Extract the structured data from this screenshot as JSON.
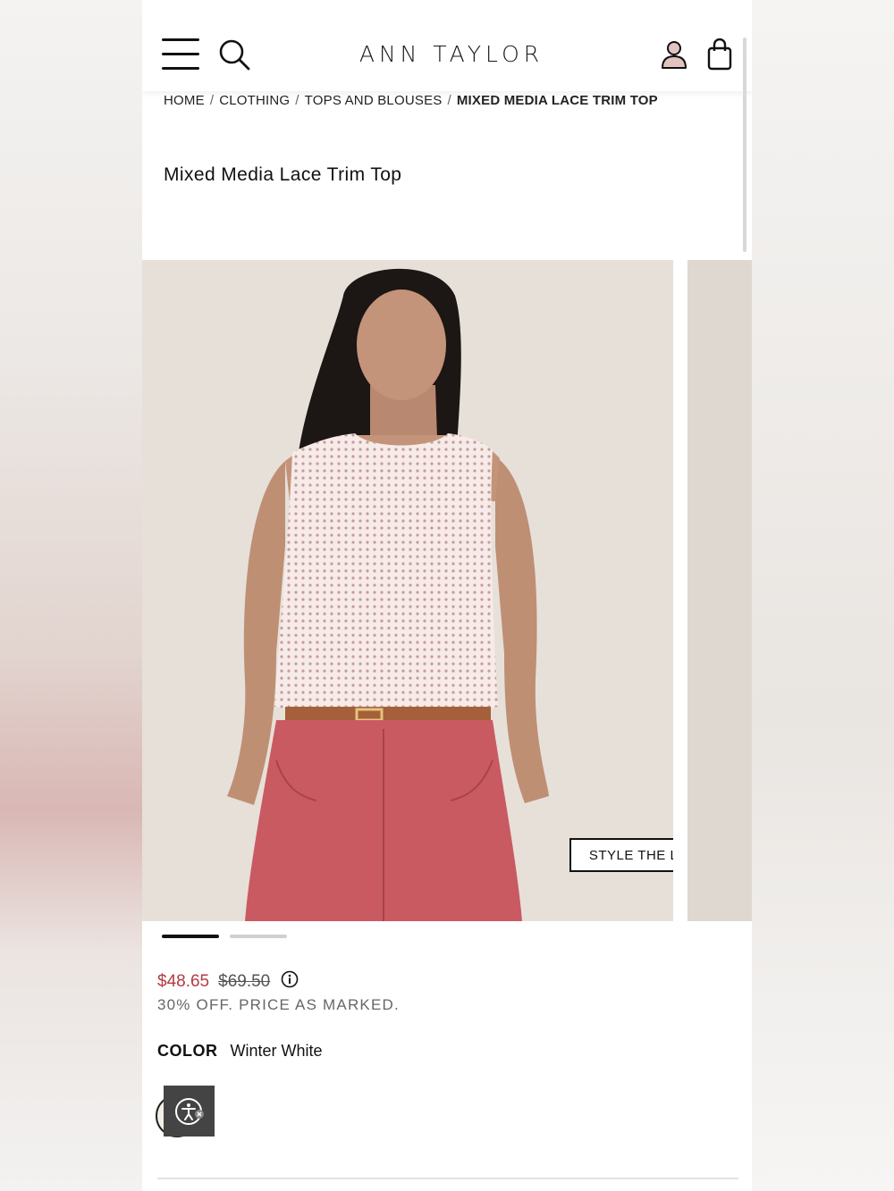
{
  "header": {
    "brand": "ANN TAYLOR",
    "menu_icon": "hamburger-menu-icon",
    "search_icon": "search-icon",
    "account_icon": "user-account-icon",
    "bag_icon": "shopping-bag-icon"
  },
  "breadcrumb": {
    "items": [
      "HOME",
      "CLOTHING",
      "TOPS AND BLOUSES",
      "MIXED MEDIA LACE TRIM TOP"
    ],
    "separator": "/"
  },
  "product": {
    "title": "Mixed Media Lace Trim Top",
    "style_the_look_label": "STYLE THE LOOK",
    "gallery_active_index": 1,
    "gallery_count": 2,
    "price_sale": "$48.65",
    "price_original": "$69.50",
    "promo_text": "30% OFF. PRICE AS MARKED.",
    "color_label": "COLOR",
    "color_value": "Winter White"
  },
  "colors": {
    "sale_price": "#b53b3f",
    "pants": "#c95a62",
    "top": "#f3e4e2",
    "photo_background": "#e6e0d9"
  },
  "accessibility_widget": {
    "icon": "accessibility-icon"
  }
}
